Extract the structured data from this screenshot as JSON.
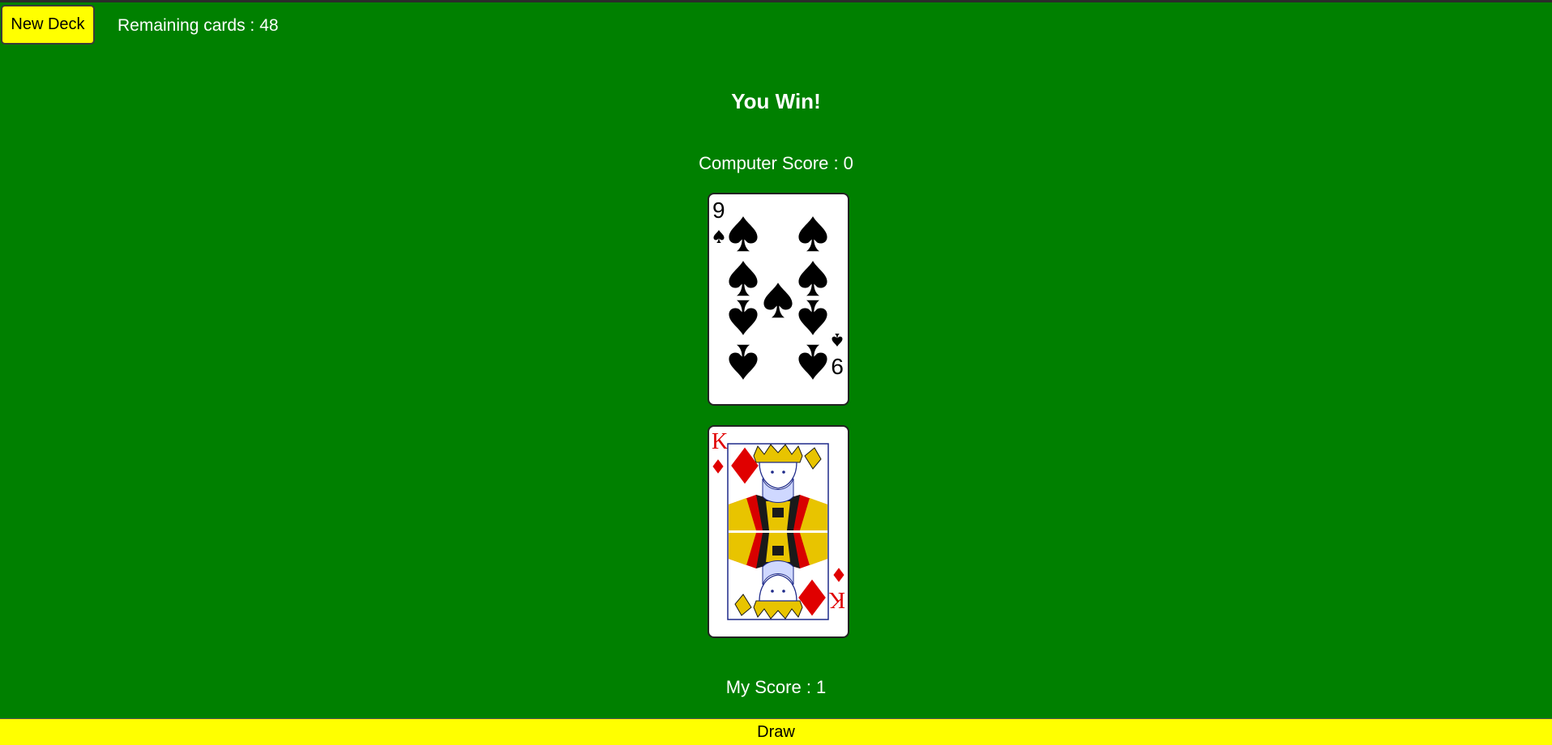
{
  "toolbar": {
    "new_deck_label": "New Deck",
    "remaining_label": "Remaining cards :",
    "remaining_count": "48"
  },
  "result_text": "You Win!",
  "computer": {
    "score_label": "Computer Score :",
    "score_value": "0",
    "card": {
      "rank": "9",
      "suit": "spades",
      "suit_symbol": "♠",
      "color": "#000000"
    }
  },
  "player": {
    "score_label": "My Score :",
    "score_value": "1",
    "card": {
      "rank": "K",
      "suit": "diamonds",
      "suit_symbol": "♦",
      "color": "#e00000"
    }
  },
  "draw_label": "Draw",
  "colors": {
    "table_green": "#008000",
    "button_yellow": "#ffff00",
    "text_white": "#ffffff"
  }
}
